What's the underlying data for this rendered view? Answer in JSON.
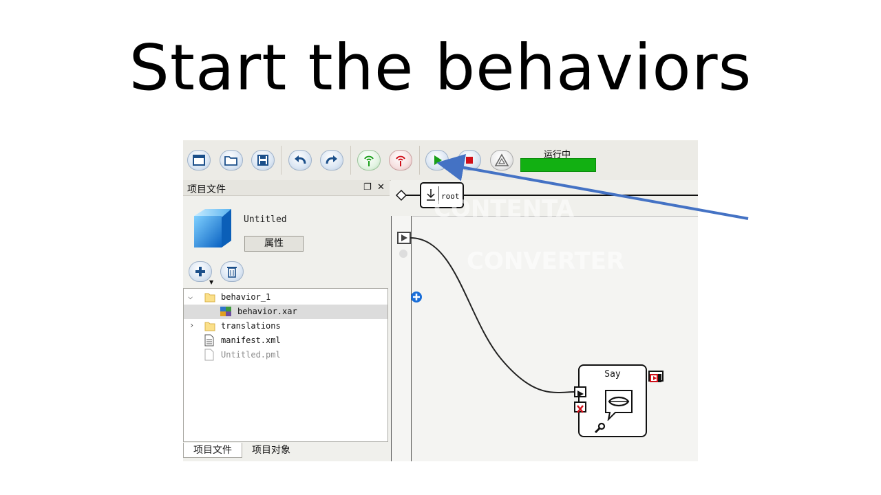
{
  "slide": {
    "title": "Start the behaviors"
  },
  "toolbar": {
    "buttons": [
      {
        "icon": "new-project-icon"
      },
      {
        "icon": "open-folder-icon"
      },
      {
        "icon": "save-icon"
      },
      {
        "icon": "undo-icon"
      },
      {
        "icon": "redo-icon"
      },
      {
        "icon": "connect-icon"
      },
      {
        "icon": "disconnect-icon"
      },
      {
        "icon": "play-icon"
      },
      {
        "icon": "stop-icon"
      },
      {
        "icon": "warning-icon"
      }
    ],
    "status_label": "运行中",
    "status_color": "#12b012"
  },
  "project_panel": {
    "title": "项目文件",
    "project_name": "Untitled",
    "properties_button": "属性",
    "tree": [
      {
        "label": "behavior_1",
        "type": "folder",
        "expanded": true
      },
      {
        "label": "behavior.xar",
        "type": "behavior-file",
        "selected": true
      },
      {
        "label": "translations",
        "type": "folder",
        "expanded": false
      },
      {
        "label": "manifest.xml",
        "type": "file"
      },
      {
        "label": "Untitled.pml",
        "type": "file-disabled"
      }
    ],
    "tabs": [
      {
        "label": "项目文件",
        "active": true
      },
      {
        "label": "项目对象",
        "active": false
      }
    ]
  },
  "canvas": {
    "breadcrumb": "root",
    "watermark_top": "CONTENTA",
    "watermark_bottom": "CONVERTER",
    "box": {
      "title": "Say"
    }
  },
  "colors": {
    "arrow": "#4472c4",
    "play": "#1a9f1a",
    "stop": "#d0101a"
  }
}
